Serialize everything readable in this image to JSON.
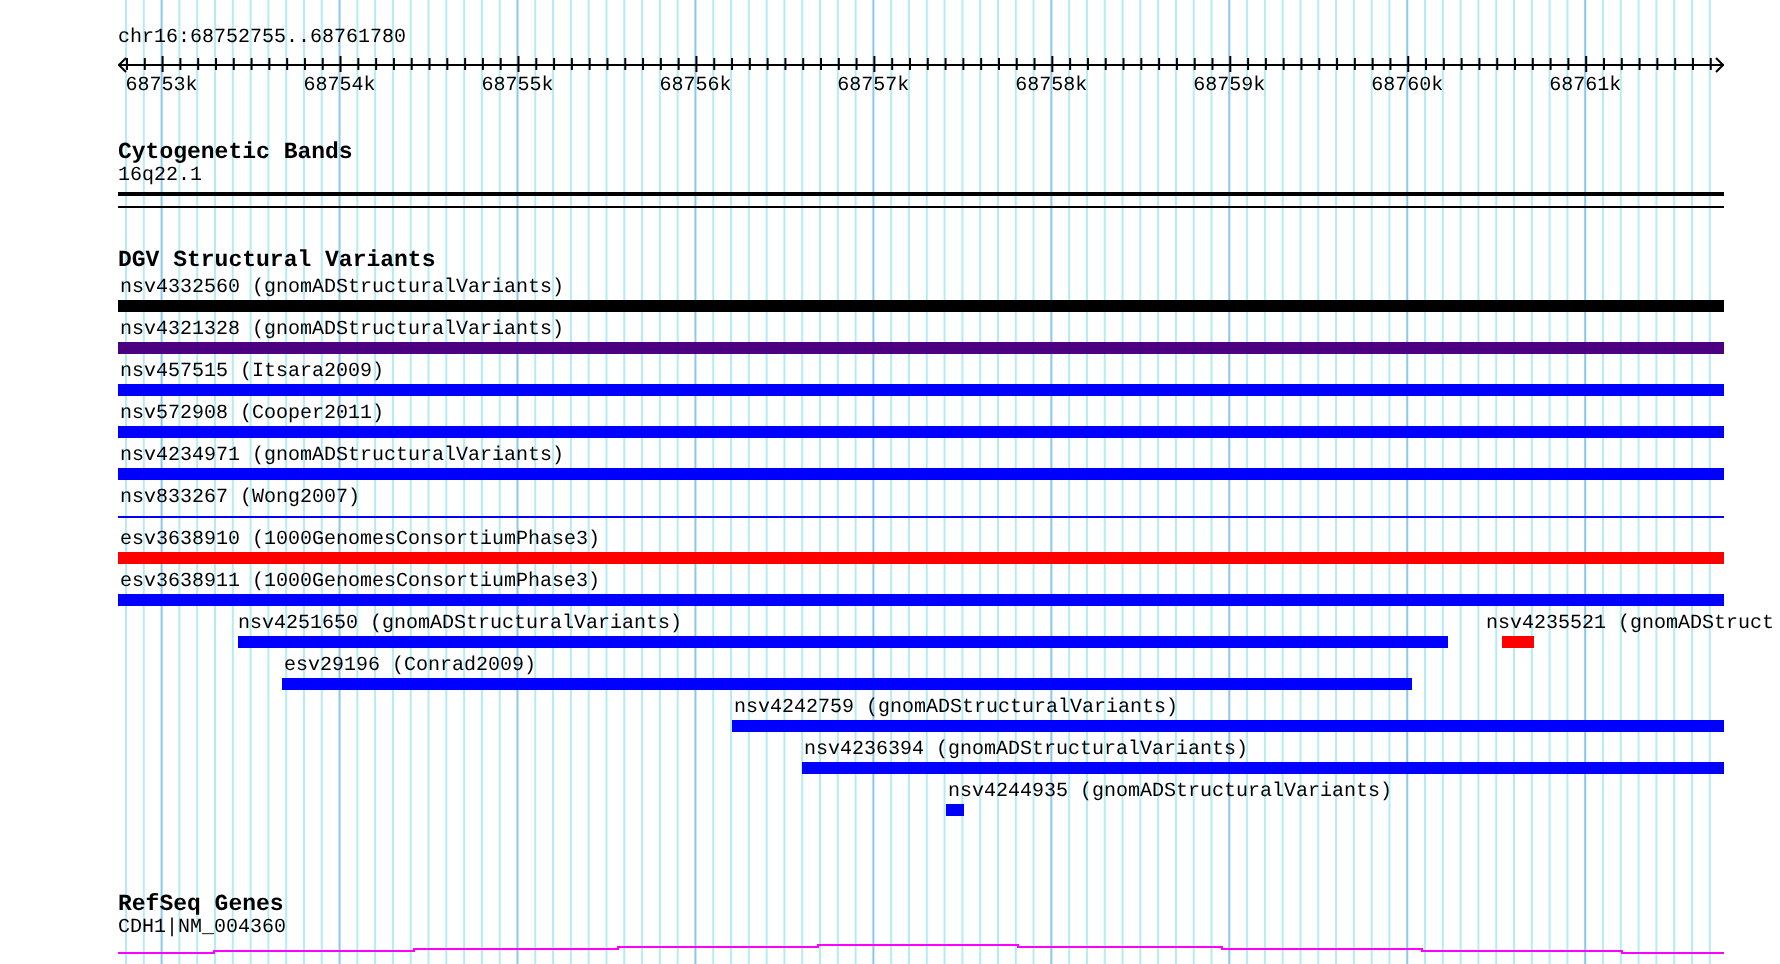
{
  "ruler": {
    "region": "chr16:68752755..68761780",
    "ticks": [
      "68753k",
      "68754k",
      "68755k",
      "68756k",
      "68757k",
      "68758k",
      "68759k",
      "68760k",
      "68761k"
    ]
  },
  "tracks": [
    {
      "kind": "cytoband",
      "title": "Cytogenetic Bands",
      "label": "16q22.1"
    },
    {
      "kind": "variants",
      "title": "DGV Structural Variants",
      "features": [
        {
          "label": "nsv4332560 (gnomADStructuralVariants)",
          "color": "#000000",
          "kind": "box"
        },
        {
          "label": "nsv4321328 (gnomADStructuralVariants)",
          "color": "#4b0082",
          "kind": "box"
        },
        {
          "label": "nsv457515 (Itsara2009)",
          "color": "#0000ff",
          "kind": "box"
        },
        {
          "label": "nsv572908 (Cooper2011)",
          "color": "#0000ff",
          "kind": "box"
        },
        {
          "label": "nsv4234971 (gnomADStructuralVariants)",
          "color": "#0000ff",
          "kind": "box"
        },
        {
          "label": "nsv833267 (Wong2007)",
          "color": "#0000ff",
          "kind": "thin"
        },
        {
          "label": "esv3638910 (1000GenomesConsortiumPhase3)",
          "color": "#ff0000",
          "kind": "box"
        },
        {
          "label": "esv3638911 (1000GenomesConsortiumPhase3)",
          "color": "#0000ff",
          "kind": "box"
        },
        {
          "label": "nsv4251650 (gnomADStructuralVariants)",
          "color": "#0000ff",
          "kind": "box"
        },
        {
          "label": "nsv4235521 (gnomADStruct",
          "color": "#ff0000",
          "kind": "box"
        },
        {
          "label": "esv29196 (Conrad2009)",
          "color": "#0000ff",
          "kind": "box"
        },
        {
          "label": "nsv4242759 (gnomADStructuralVariants)",
          "color": "#0000ff",
          "kind": "box"
        },
        {
          "label": "nsv4236394 (gnomADStructuralVariants)",
          "color": "#0000ff",
          "kind": "box"
        },
        {
          "label": "nsv4244935 (gnomADStructuralVariants)",
          "color": "#0000ff",
          "kind": "box"
        }
      ]
    },
    {
      "kind": "gene",
      "title": "RefSeq Genes",
      "label": "CDH1|NM_004360"
    }
  ]
}
